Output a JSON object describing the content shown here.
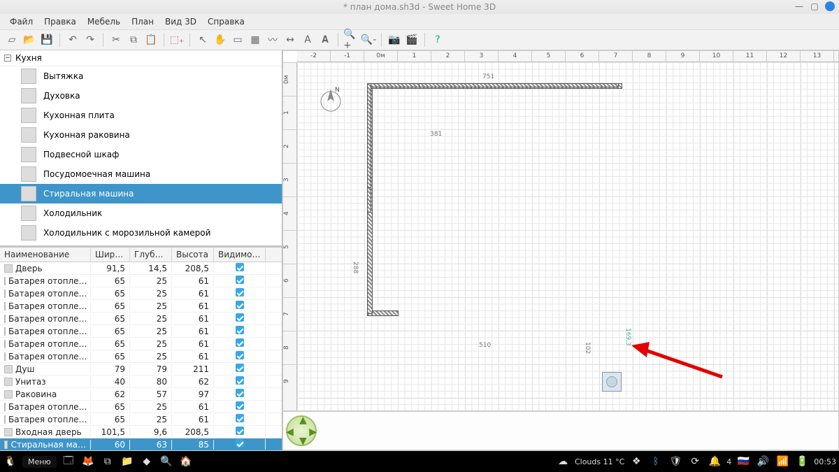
{
  "window": {
    "title": "* план дома.sh3d - Sweet Home 3D",
    "min": "—",
    "max": "▢",
    "close": "×"
  },
  "menu": {
    "file": "Файл",
    "edit": "Правка",
    "furniture": "Мебель",
    "plan": "План",
    "view3d": "Вид 3D",
    "help": "Справка"
  },
  "catalog": {
    "category": "Кухня",
    "items": [
      "Вытяжка",
      "Духовка",
      "Кухонная плита",
      "Кухонная раковина",
      "Подвесной шкаф",
      "Посудомоечная машина",
      "Стиральная машина",
      "Холодильник",
      "Холодильник с морозильной камерой"
    ],
    "selected_index": 6
  },
  "furniture_table": {
    "headers": {
      "name": "Наименование",
      "width": "Ширина",
      "depth": "Глубина",
      "height": "Высота",
      "visible": "Видимость"
    },
    "rows": [
      {
        "name": "Дверь",
        "width": "91,5",
        "depth": "14,5",
        "height": "208,5"
      },
      {
        "name": "Батарея отопле…",
        "width": "65",
        "depth": "25",
        "height": "61"
      },
      {
        "name": "Батарея отопле…",
        "width": "65",
        "depth": "25",
        "height": "61"
      },
      {
        "name": "Батарея отопле…",
        "width": "65",
        "depth": "25",
        "height": "61"
      },
      {
        "name": "Батарея отопле…",
        "width": "65",
        "depth": "25",
        "height": "61"
      },
      {
        "name": "Батарея отопле…",
        "width": "65",
        "depth": "25",
        "height": "61"
      },
      {
        "name": "Батарея отопле…",
        "width": "65",
        "depth": "25",
        "height": "61"
      },
      {
        "name": "Батарея отопле…",
        "width": "65",
        "depth": "25",
        "height": "61"
      },
      {
        "name": "Душ",
        "width": "79",
        "depth": "79",
        "height": "211"
      },
      {
        "name": "Унитаз",
        "width": "40",
        "depth": "80",
        "height": "62"
      },
      {
        "name": "Раковина",
        "width": "62",
        "depth": "57",
        "height": "97"
      },
      {
        "name": "Батарея отопле…",
        "width": "65",
        "depth": "25",
        "height": "61"
      },
      {
        "name": "Батарея отопле…",
        "width": "65",
        "depth": "25",
        "height": "61"
      },
      {
        "name": "Входная дверь",
        "width": "101,5",
        "depth": "9,6",
        "height": "208,5"
      },
      {
        "name": "Стиральная ма…",
        "width": "60",
        "depth": "63",
        "height": "85",
        "selected": true
      }
    ]
  },
  "plan": {
    "ruler_top": [
      "-2",
      "-1",
      "0м",
      "1",
      "2",
      "3",
      "4",
      "5",
      "6",
      "7",
      "8",
      "9",
      "10",
      "11",
      "12",
      "13"
    ],
    "ruler_left": [
      "0м",
      "1",
      "2",
      "3",
      "4",
      "5",
      "6",
      "7",
      "8",
      "9"
    ],
    "dims": {
      "a": "751",
      "b": "381",
      "c": "288",
      "d": "510",
      "e": "169,3",
      "f": "102"
    },
    "compass": "N"
  },
  "taskbar": {
    "menu": "Меню",
    "weather": "Clouds 11 °C",
    "battery_count": "4",
    "time": "00:53"
  }
}
